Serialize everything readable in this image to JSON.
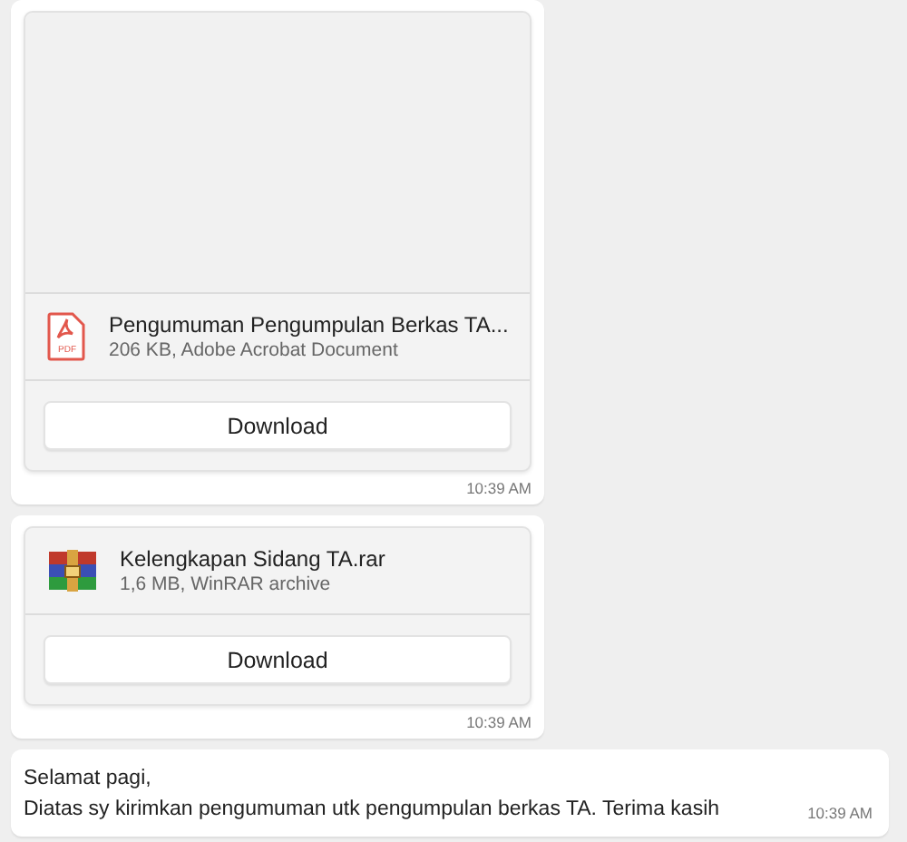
{
  "messages": [
    {
      "kind": "file",
      "preview": true,
      "icon": {
        "kind": "pdf",
        "label": "PDF"
      },
      "file_name": "Pengumuman Pengumpulan Berkas TA...",
      "file_info": "206 KB, Adobe Acrobat Document",
      "button": "Download",
      "time": "10:39 AM"
    },
    {
      "kind": "file",
      "preview": false,
      "icon": {
        "kind": "archive"
      },
      "file_name": "Kelengkapan Sidang TA.rar",
      "file_info": "1,6 MB, WinRAR archive",
      "button": "Download",
      "time": "10:39 AM"
    },
    {
      "kind": "text",
      "lines": [
        "Selamat pagi,",
        "Diatas sy kirimkan pengumuman utk pengumpulan berkas TA. Terima kasih"
      ],
      "time": "10:39 AM"
    }
  ]
}
